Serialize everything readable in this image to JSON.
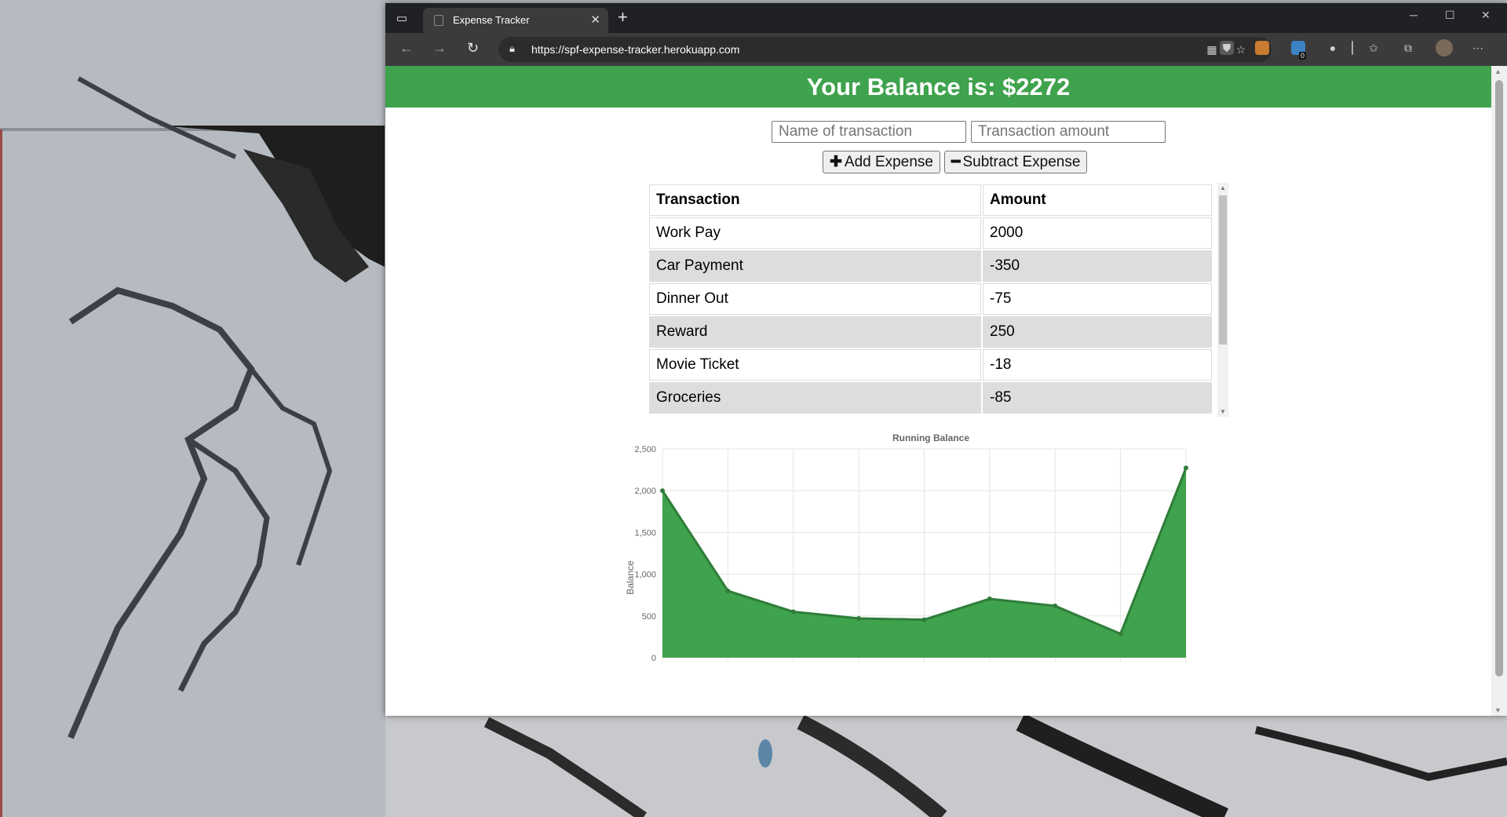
{
  "browser": {
    "tab_title": "Expense Tracker",
    "url": "https://spf-expense-tracker.herokuapp.com",
    "icons": [
      "tab-actions-icon",
      "back-icon",
      "forward-icon",
      "reload-icon",
      "lock-icon",
      "reader-icon",
      "add-favorite-icon",
      "shield-icon",
      "extension-icon",
      "extension-badge-icon",
      "profile-icon",
      "favorites-icon",
      "collections-icon",
      "avatar",
      "more-icon"
    ],
    "ext_badge_count": "0"
  },
  "page": {
    "balance_text": "Your Balance is: $2272",
    "name_placeholder": "Name of transaction",
    "amount_placeholder": "Transaction amount",
    "add_label": "Add Expense",
    "subtract_label": "Subtract Expense",
    "table": {
      "headers": [
        "Transaction",
        "Amount"
      ],
      "rows": [
        {
          "name": "Work Pay",
          "amount": "2000"
        },
        {
          "name": "Car Payment",
          "amount": "-350"
        },
        {
          "name": "Dinner Out",
          "amount": "-75"
        },
        {
          "name": "Reward",
          "amount": "250"
        },
        {
          "name": "Movie Ticket",
          "amount": "-18"
        },
        {
          "name": "Groceries",
          "amount": "-85"
        }
      ]
    },
    "accent": "#3fa24c"
  },
  "chart_data": {
    "type": "area",
    "title": "Running Balance",
    "ylabel": "Balance",
    "xlabel": "",
    "x": [
      1,
      2,
      3,
      4,
      5,
      6,
      7,
      8,
      9
    ],
    "values": [
      2000,
      800,
      550,
      470,
      455,
      705,
      620,
      285,
      2272
    ],
    "ylim": [
      0,
      2500
    ],
    "yticks": [
      0,
      500,
      1000,
      1500,
      2000,
      2500
    ],
    "ytick_labels": [
      "0",
      "500",
      "1,000",
      "1,500",
      "2,000",
      "2,500"
    ],
    "grid": true,
    "color": "#3fa24c",
    "line_color": "#2f7d3a"
  }
}
